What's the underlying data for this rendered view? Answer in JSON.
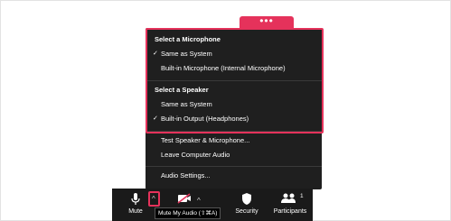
{
  "more_button": {
    "label": "•••"
  },
  "menu": {
    "microphone_heading": "Select a Microphone",
    "microphones": [
      {
        "label": "Same as System",
        "checked": true
      },
      {
        "label": "Built-in Microphone (Internal Microphone)",
        "checked": false
      }
    ],
    "speaker_heading": "Select a Speaker",
    "speakers": [
      {
        "label": "Same as System",
        "checked": false
      },
      {
        "label": "Built-in Output (Headphones)",
        "checked": true
      }
    ],
    "test": "Test Speaker & Microphone...",
    "leave": "Leave Computer Audio",
    "settings": "Audio Settings...",
    "checkmark": "✓"
  },
  "toolbar": {
    "mute_label": "Mute",
    "caret": "^",
    "security_label": "Security",
    "participants_label": "Participants",
    "participants_count": "1"
  },
  "tooltip": "Mute My Audio (⇧⌘A)",
  "colors": {
    "accent": "#e5325b",
    "menu_bg": "#1f1f1f",
    "toolbar_bg": "#1a1a1a"
  }
}
